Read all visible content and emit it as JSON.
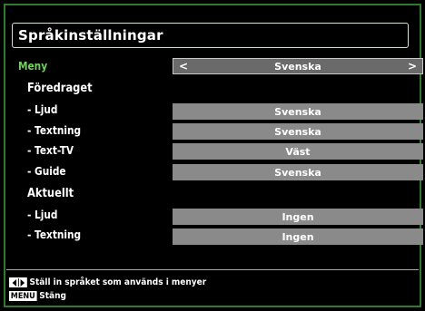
{
  "title": "Språkinställningar",
  "menu_row": {
    "label": "Meny",
    "value": "Svenska",
    "left_arrow": "<",
    "right_arrow": ">"
  },
  "preferred": {
    "heading": "Föredraget",
    "rows": [
      {
        "label": "- Ljud",
        "value": "Svenska"
      },
      {
        "label": "- Textning",
        "value": "Svenska"
      },
      {
        "label": "- Text-TV",
        "value": "Väst"
      },
      {
        "label": "- Guide",
        "value": "Svenska"
      }
    ]
  },
  "current": {
    "heading": "Aktuellt",
    "rows": [
      {
        "label": "- Ljud",
        "value": "Ingen"
      },
      {
        "label": "- Textning",
        "value": "Ingen"
      }
    ]
  },
  "help": {
    "nav_text": "Ställ in språket som används i menyer",
    "menu_key": "MENU",
    "menu_text": "Stäng"
  }
}
